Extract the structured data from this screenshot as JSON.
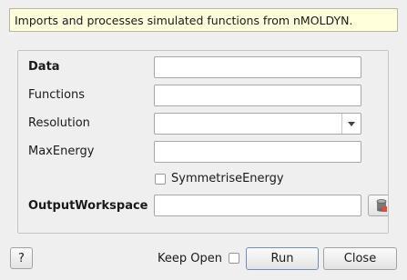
{
  "description": "Imports and processes simulated functions from nMOLDYN.",
  "properties": {
    "data": {
      "label": "Data",
      "value": ""
    },
    "functions": {
      "label": "Functions",
      "value": ""
    },
    "resolution": {
      "label": "Resolution",
      "value": ""
    },
    "max_energy": {
      "label": "MaxEnergy",
      "value": ""
    },
    "symmetrise_energy": {
      "label": "SymmetriseEnergy",
      "checked": false
    },
    "output_workspace": {
      "label": "OutputWorkspace",
      "value": ""
    }
  },
  "footer": {
    "help_label": "?",
    "keep_open_label": "Keep Open",
    "keep_open_checked": false,
    "run_label": "Run",
    "close_label": "Close"
  },
  "icons": {
    "browse": "database-icon",
    "dropdown": "chevron-down-icon"
  },
  "colors": {
    "description_background": "#ffffdc",
    "window_background": "#efefef",
    "default_button_border": "#6f8fb8"
  }
}
